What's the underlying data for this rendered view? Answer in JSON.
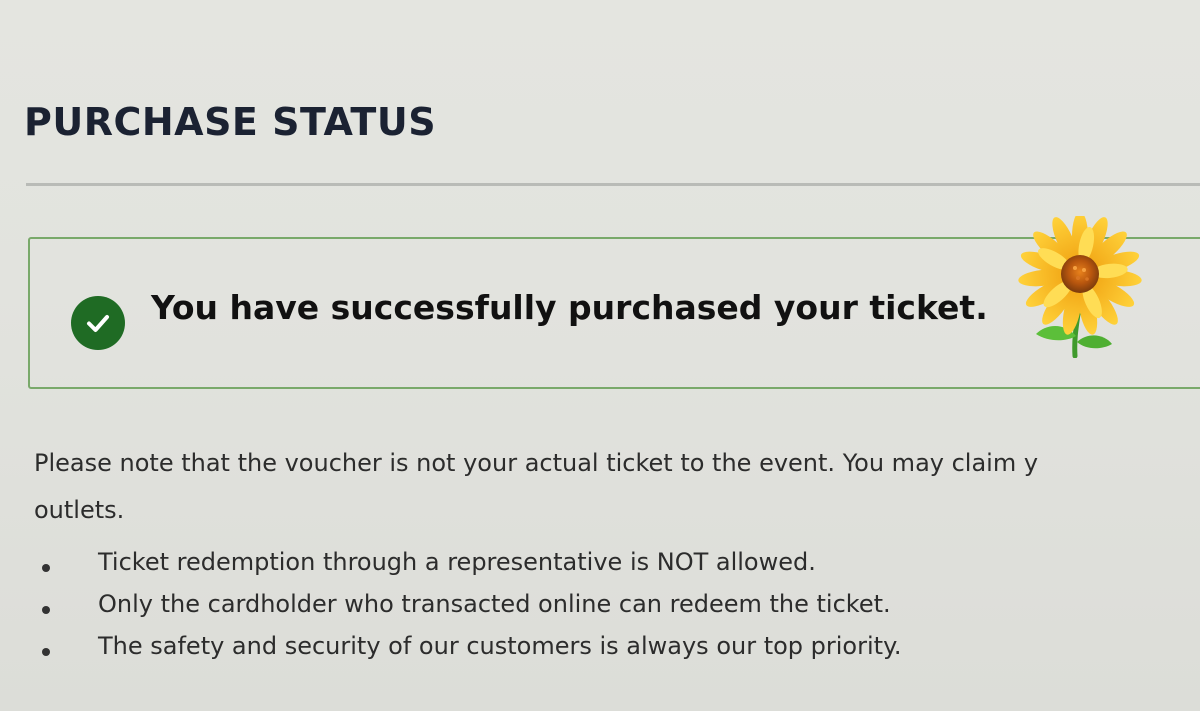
{
  "header": {
    "title": "PURCHASE STATUS"
  },
  "alert": {
    "message": "You have successfully purchased your ticket.",
    "icon": "check-circle-icon",
    "icon_color": "#1f6b24",
    "border_color": "#79a96a"
  },
  "decoration": {
    "icon": "sunflower-icon"
  },
  "note": {
    "line1": "Please note that the voucher is not your actual ticket to the event. You may claim y",
    "line2": "outlets."
  },
  "rules": [
    "Ticket redemption through a representative is NOT allowed.",
    "Only the cardholder who transacted online can redeem the ticket.",
    "The safety and security of our customers is always our top priority."
  ]
}
